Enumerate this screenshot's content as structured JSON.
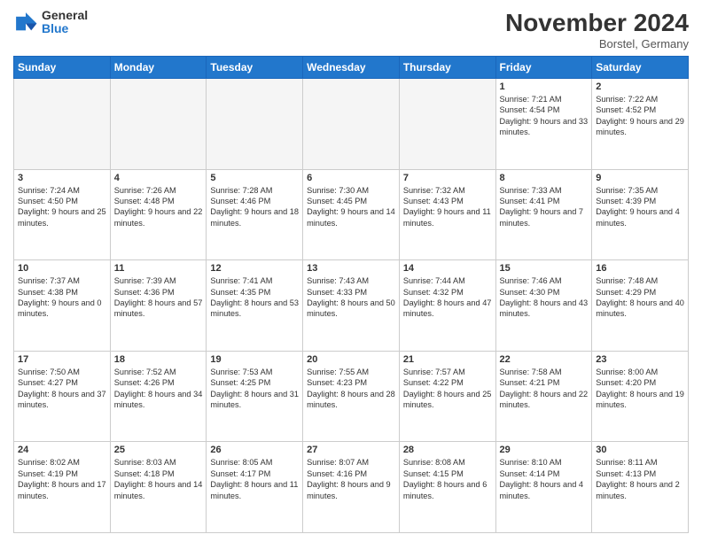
{
  "header": {
    "logo_general": "General",
    "logo_blue": "Blue",
    "month_title": "November 2024",
    "location": "Borstel, Germany"
  },
  "days_of_week": [
    "Sunday",
    "Monday",
    "Tuesday",
    "Wednesday",
    "Thursday",
    "Friday",
    "Saturday"
  ],
  "weeks": [
    [
      {
        "num": "",
        "info": ""
      },
      {
        "num": "",
        "info": ""
      },
      {
        "num": "",
        "info": ""
      },
      {
        "num": "",
        "info": ""
      },
      {
        "num": "",
        "info": ""
      },
      {
        "num": "1",
        "info": "Sunrise: 7:21 AM\nSunset: 4:54 PM\nDaylight: 9 hours and 33 minutes."
      },
      {
        "num": "2",
        "info": "Sunrise: 7:22 AM\nSunset: 4:52 PM\nDaylight: 9 hours and 29 minutes."
      }
    ],
    [
      {
        "num": "3",
        "info": "Sunrise: 7:24 AM\nSunset: 4:50 PM\nDaylight: 9 hours and 25 minutes."
      },
      {
        "num": "4",
        "info": "Sunrise: 7:26 AM\nSunset: 4:48 PM\nDaylight: 9 hours and 22 minutes."
      },
      {
        "num": "5",
        "info": "Sunrise: 7:28 AM\nSunset: 4:46 PM\nDaylight: 9 hours and 18 minutes."
      },
      {
        "num": "6",
        "info": "Sunrise: 7:30 AM\nSunset: 4:45 PM\nDaylight: 9 hours and 14 minutes."
      },
      {
        "num": "7",
        "info": "Sunrise: 7:32 AM\nSunset: 4:43 PM\nDaylight: 9 hours and 11 minutes."
      },
      {
        "num": "8",
        "info": "Sunrise: 7:33 AM\nSunset: 4:41 PM\nDaylight: 9 hours and 7 minutes."
      },
      {
        "num": "9",
        "info": "Sunrise: 7:35 AM\nSunset: 4:39 PM\nDaylight: 9 hours and 4 minutes."
      }
    ],
    [
      {
        "num": "10",
        "info": "Sunrise: 7:37 AM\nSunset: 4:38 PM\nDaylight: 9 hours and 0 minutes."
      },
      {
        "num": "11",
        "info": "Sunrise: 7:39 AM\nSunset: 4:36 PM\nDaylight: 8 hours and 57 minutes."
      },
      {
        "num": "12",
        "info": "Sunrise: 7:41 AM\nSunset: 4:35 PM\nDaylight: 8 hours and 53 minutes."
      },
      {
        "num": "13",
        "info": "Sunrise: 7:43 AM\nSunset: 4:33 PM\nDaylight: 8 hours and 50 minutes."
      },
      {
        "num": "14",
        "info": "Sunrise: 7:44 AM\nSunset: 4:32 PM\nDaylight: 8 hours and 47 minutes."
      },
      {
        "num": "15",
        "info": "Sunrise: 7:46 AM\nSunset: 4:30 PM\nDaylight: 8 hours and 43 minutes."
      },
      {
        "num": "16",
        "info": "Sunrise: 7:48 AM\nSunset: 4:29 PM\nDaylight: 8 hours and 40 minutes."
      }
    ],
    [
      {
        "num": "17",
        "info": "Sunrise: 7:50 AM\nSunset: 4:27 PM\nDaylight: 8 hours and 37 minutes."
      },
      {
        "num": "18",
        "info": "Sunrise: 7:52 AM\nSunset: 4:26 PM\nDaylight: 8 hours and 34 minutes."
      },
      {
        "num": "19",
        "info": "Sunrise: 7:53 AM\nSunset: 4:25 PM\nDaylight: 8 hours and 31 minutes."
      },
      {
        "num": "20",
        "info": "Sunrise: 7:55 AM\nSunset: 4:23 PM\nDaylight: 8 hours and 28 minutes."
      },
      {
        "num": "21",
        "info": "Sunrise: 7:57 AM\nSunset: 4:22 PM\nDaylight: 8 hours and 25 minutes."
      },
      {
        "num": "22",
        "info": "Sunrise: 7:58 AM\nSunset: 4:21 PM\nDaylight: 8 hours and 22 minutes."
      },
      {
        "num": "23",
        "info": "Sunrise: 8:00 AM\nSunset: 4:20 PM\nDaylight: 8 hours and 19 minutes."
      }
    ],
    [
      {
        "num": "24",
        "info": "Sunrise: 8:02 AM\nSunset: 4:19 PM\nDaylight: 8 hours and 17 minutes."
      },
      {
        "num": "25",
        "info": "Sunrise: 8:03 AM\nSunset: 4:18 PM\nDaylight: 8 hours and 14 minutes."
      },
      {
        "num": "26",
        "info": "Sunrise: 8:05 AM\nSunset: 4:17 PM\nDaylight: 8 hours and 11 minutes."
      },
      {
        "num": "27",
        "info": "Sunrise: 8:07 AM\nSunset: 4:16 PM\nDaylight: 8 hours and 9 minutes."
      },
      {
        "num": "28",
        "info": "Sunrise: 8:08 AM\nSunset: 4:15 PM\nDaylight: 8 hours and 6 minutes."
      },
      {
        "num": "29",
        "info": "Sunrise: 8:10 AM\nSunset: 4:14 PM\nDaylight: 8 hours and 4 minutes."
      },
      {
        "num": "30",
        "info": "Sunrise: 8:11 AM\nSunset: 4:13 PM\nDaylight: 8 hours and 2 minutes."
      }
    ]
  ]
}
